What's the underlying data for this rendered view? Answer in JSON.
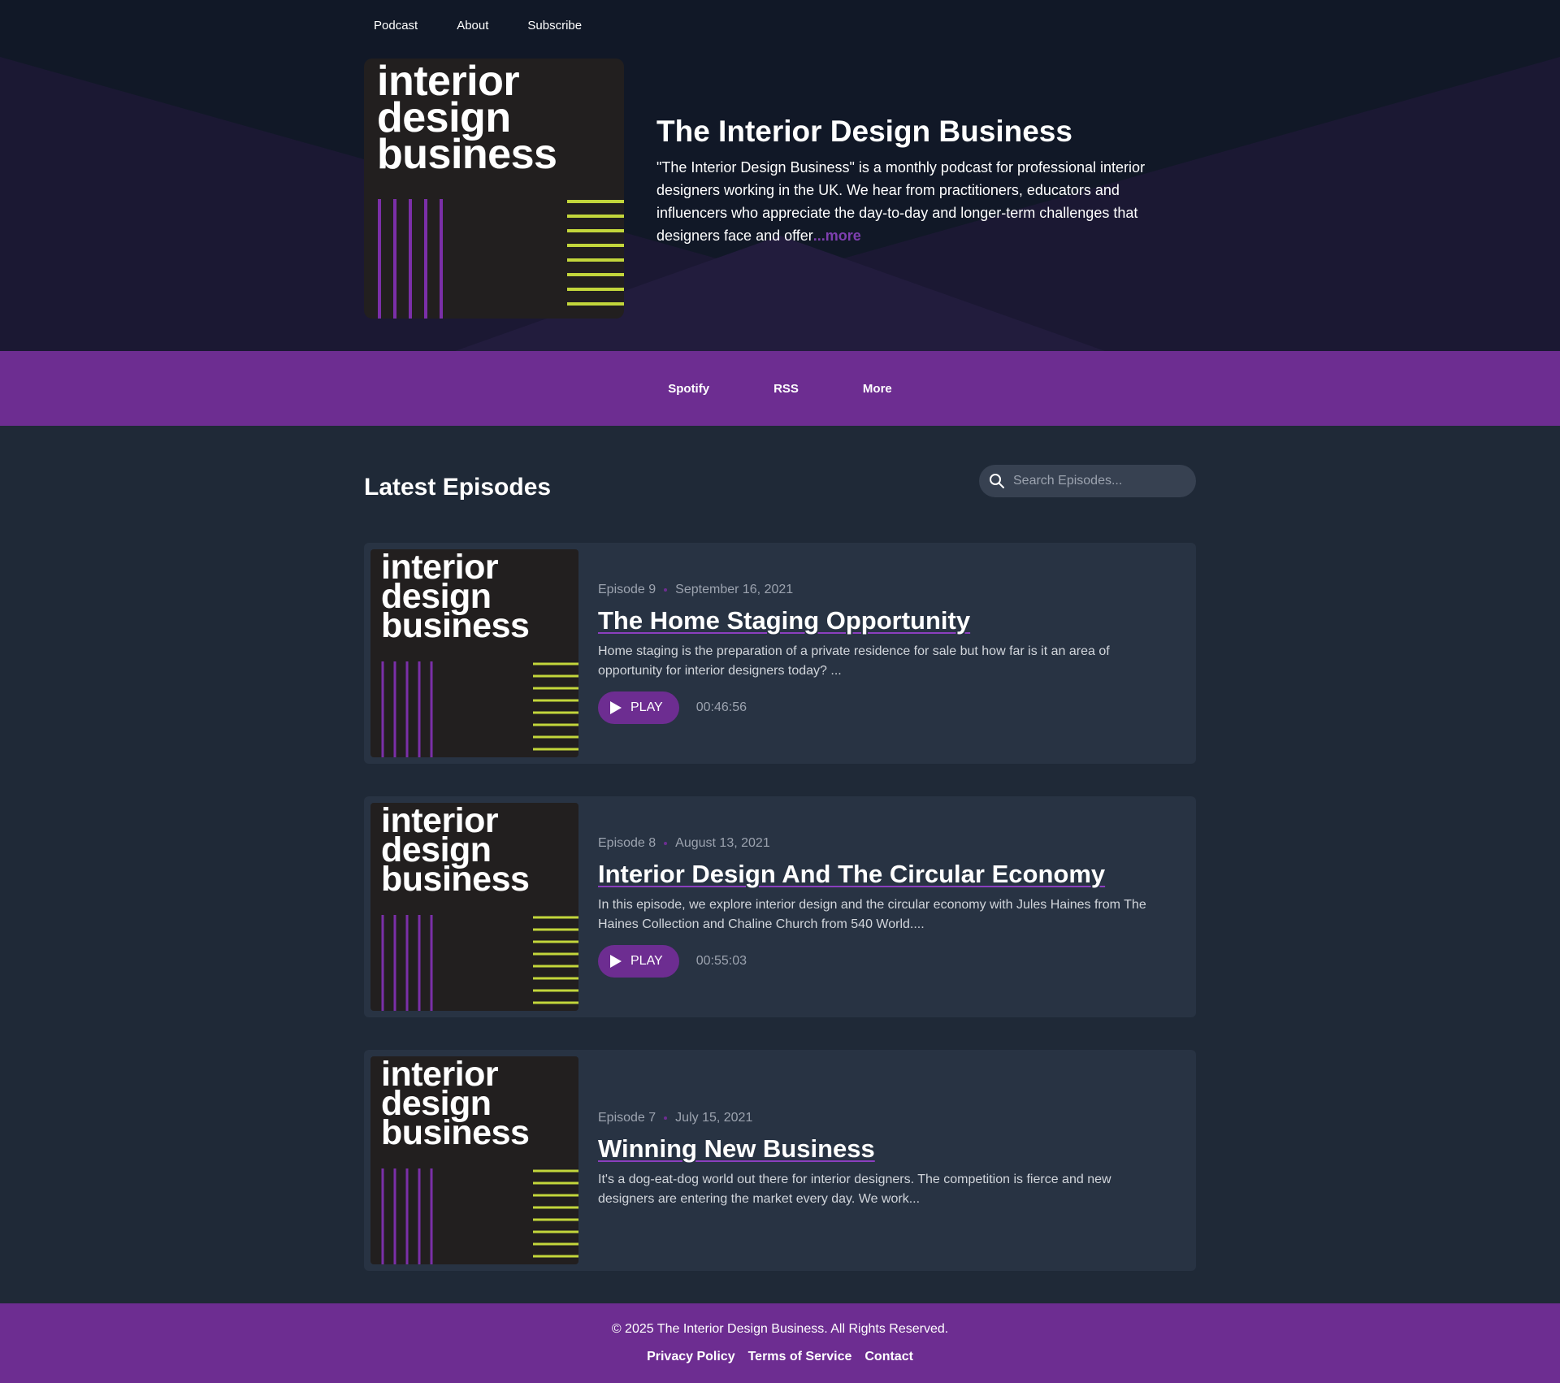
{
  "nav": {
    "items": [
      {
        "label": "Podcast"
      },
      {
        "label": "About"
      },
      {
        "label": "Subscribe"
      }
    ]
  },
  "cover": {
    "line1": "interior",
    "line2": "design",
    "line3": "business"
  },
  "hero": {
    "title": "The Interior Design Business",
    "description": "\"The Interior Design Business\" is a monthly podcast for professional interior designers working in the UK. We hear from practitioners, educators and influencers who appreciate the day-to-day and longer-term challenges that designers face and offer",
    "more_label": "...more"
  },
  "platforms": [
    {
      "label": "Spotify"
    },
    {
      "label": "RSS"
    },
    {
      "label": "More"
    }
  ],
  "episodes_section": {
    "title": "Latest Episodes",
    "search_placeholder": "Search Episodes..."
  },
  "episodes": [
    {
      "number": "Episode 9",
      "date": "September 16, 2021",
      "title": "The Home Staging Opportunity",
      "description": "Home staging is the preparation of a private residence for sale but how far is it an area of opportunity for interior designers today?    ...",
      "play_label": "PLAY",
      "duration": "00:46:56"
    },
    {
      "number": "Episode 8",
      "date": "August 13, 2021",
      "title": "Interior Design And The Circular Economy",
      "description": "In this episode, we explore interior design and the circular economy with Jules Haines from The Haines Collection and Chaline Church from 540 World....",
      "play_label": "PLAY",
      "duration": "00:55:03"
    },
    {
      "number": "Episode 7",
      "date": "July 15, 2021",
      "title": "Winning New Business",
      "description": "It's a dog-eat-dog world out there for interior designers. The competition is fierce and new designers are entering the market every day. We work..."
    }
  ],
  "footer": {
    "copyright": "© 2025 The Interior Design Business. All Rights Reserved.",
    "links": [
      {
        "label": "Privacy Policy"
      },
      {
        "label": "Terms of Service"
      },
      {
        "label": "Contact"
      }
    ]
  },
  "colors": {
    "brand_purple": "#6d2d91",
    "stripe_purple": "#7b2fa8",
    "stripe_lime": "#c3d63b",
    "cover_bg": "#221f1f",
    "page_bg": "#1f2937",
    "card_bg": "#283343"
  }
}
